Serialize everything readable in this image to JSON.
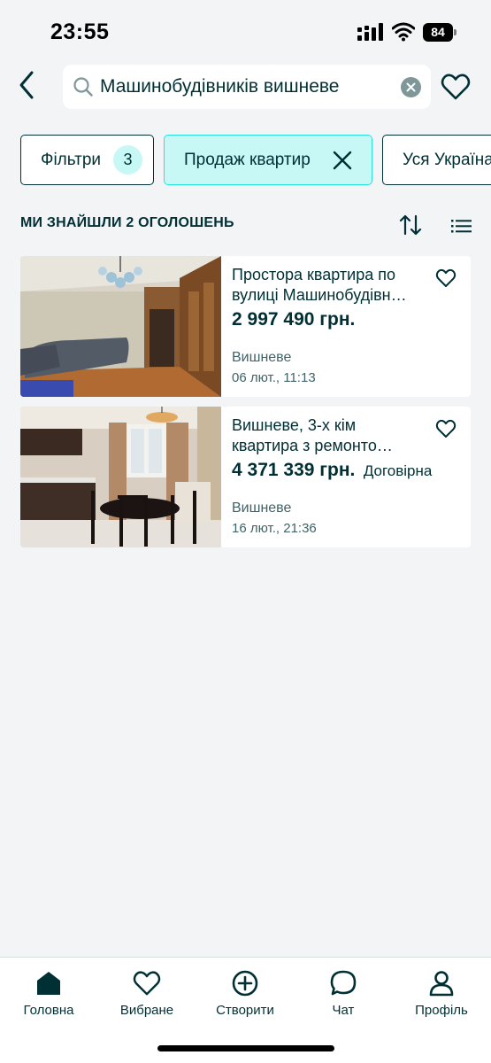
{
  "status_bar": {
    "time": "23:55",
    "battery": "84"
  },
  "search": {
    "query": "Машинобудівників вишневе"
  },
  "chips": {
    "filters": {
      "label": "Фільтри",
      "count": "3"
    },
    "category": {
      "label": "Продаж квартир"
    },
    "region": {
      "label": "Уся Україна"
    }
  },
  "results": {
    "title": "МИ ЗНАЙШЛИ 2 ОГОЛОШЕНЬ"
  },
  "listings": [
    {
      "title_line1": "Простора квартира по",
      "title_line2": "вулиці Машинобудівн…",
      "price": "2 997 490 грн.",
      "negotiable": "",
      "location": "Вишневе",
      "date": "06 лют., 11:13"
    },
    {
      "title_line1": "Вишневе, 3-х кім",
      "title_line2": "квартира  з ремонто…",
      "price": "4 371 339 грн.",
      "negotiable": "Договірна",
      "location": "Вишневе",
      "date": "16 лют., 21:36"
    }
  ],
  "tab_bar": {
    "home": "Головна",
    "favorites": "Вибране",
    "create": "Створити",
    "chat": "Чат",
    "profile": "Профіль"
  },
  "colors": {
    "brand_dark": "#002f34",
    "accent_teal": "#23e5db",
    "chip_active_bg": "#c8f8f6",
    "background": "#f2f4f5"
  }
}
